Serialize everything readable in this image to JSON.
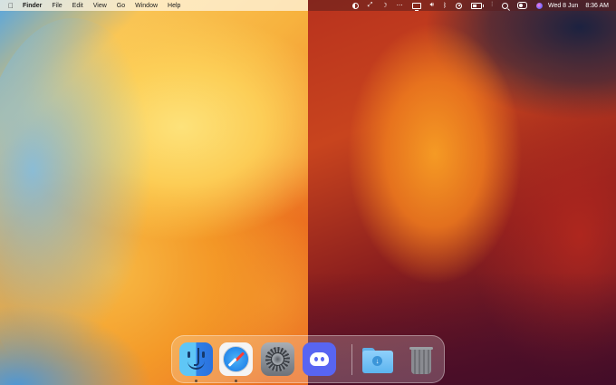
{
  "menubar": {
    "apple_icon": "apple-logo",
    "app_name": "Finder",
    "menus": [
      "File",
      "Edit",
      "View",
      "Go",
      "Window",
      "Help"
    ],
    "status_icons": [
      "dark-mode-icon",
      "screen-mirroring-icon",
      "moon-icon",
      "stage-manager-icon",
      "display-icon",
      "volume-icon",
      "bluetooth-icon",
      "focus-icon",
      "battery-icon",
      "wifi-icon",
      "search-icon",
      "control-center-icon",
      "siri-icon"
    ],
    "date": "Wed 8 Jun",
    "time": "8:36 AM"
  },
  "dock": {
    "apps": [
      {
        "name": "Finder",
        "icon": "finder-icon",
        "running": true
      },
      {
        "name": "Safari",
        "icon": "safari-icon",
        "running": true
      },
      {
        "name": "System Settings",
        "icon": "settings-icon",
        "running": false
      },
      {
        "name": "Discord",
        "icon": "discord-icon",
        "running": false
      }
    ],
    "stacks": [
      {
        "name": "Downloads",
        "icon": "downloads-folder-icon"
      },
      {
        "name": "Trash",
        "icon": "trash-icon"
      }
    ]
  },
  "colors": {
    "discord": "#5865f2",
    "finder_light": "#5fc6f6",
    "finder_dark": "#2f7fe6"
  }
}
